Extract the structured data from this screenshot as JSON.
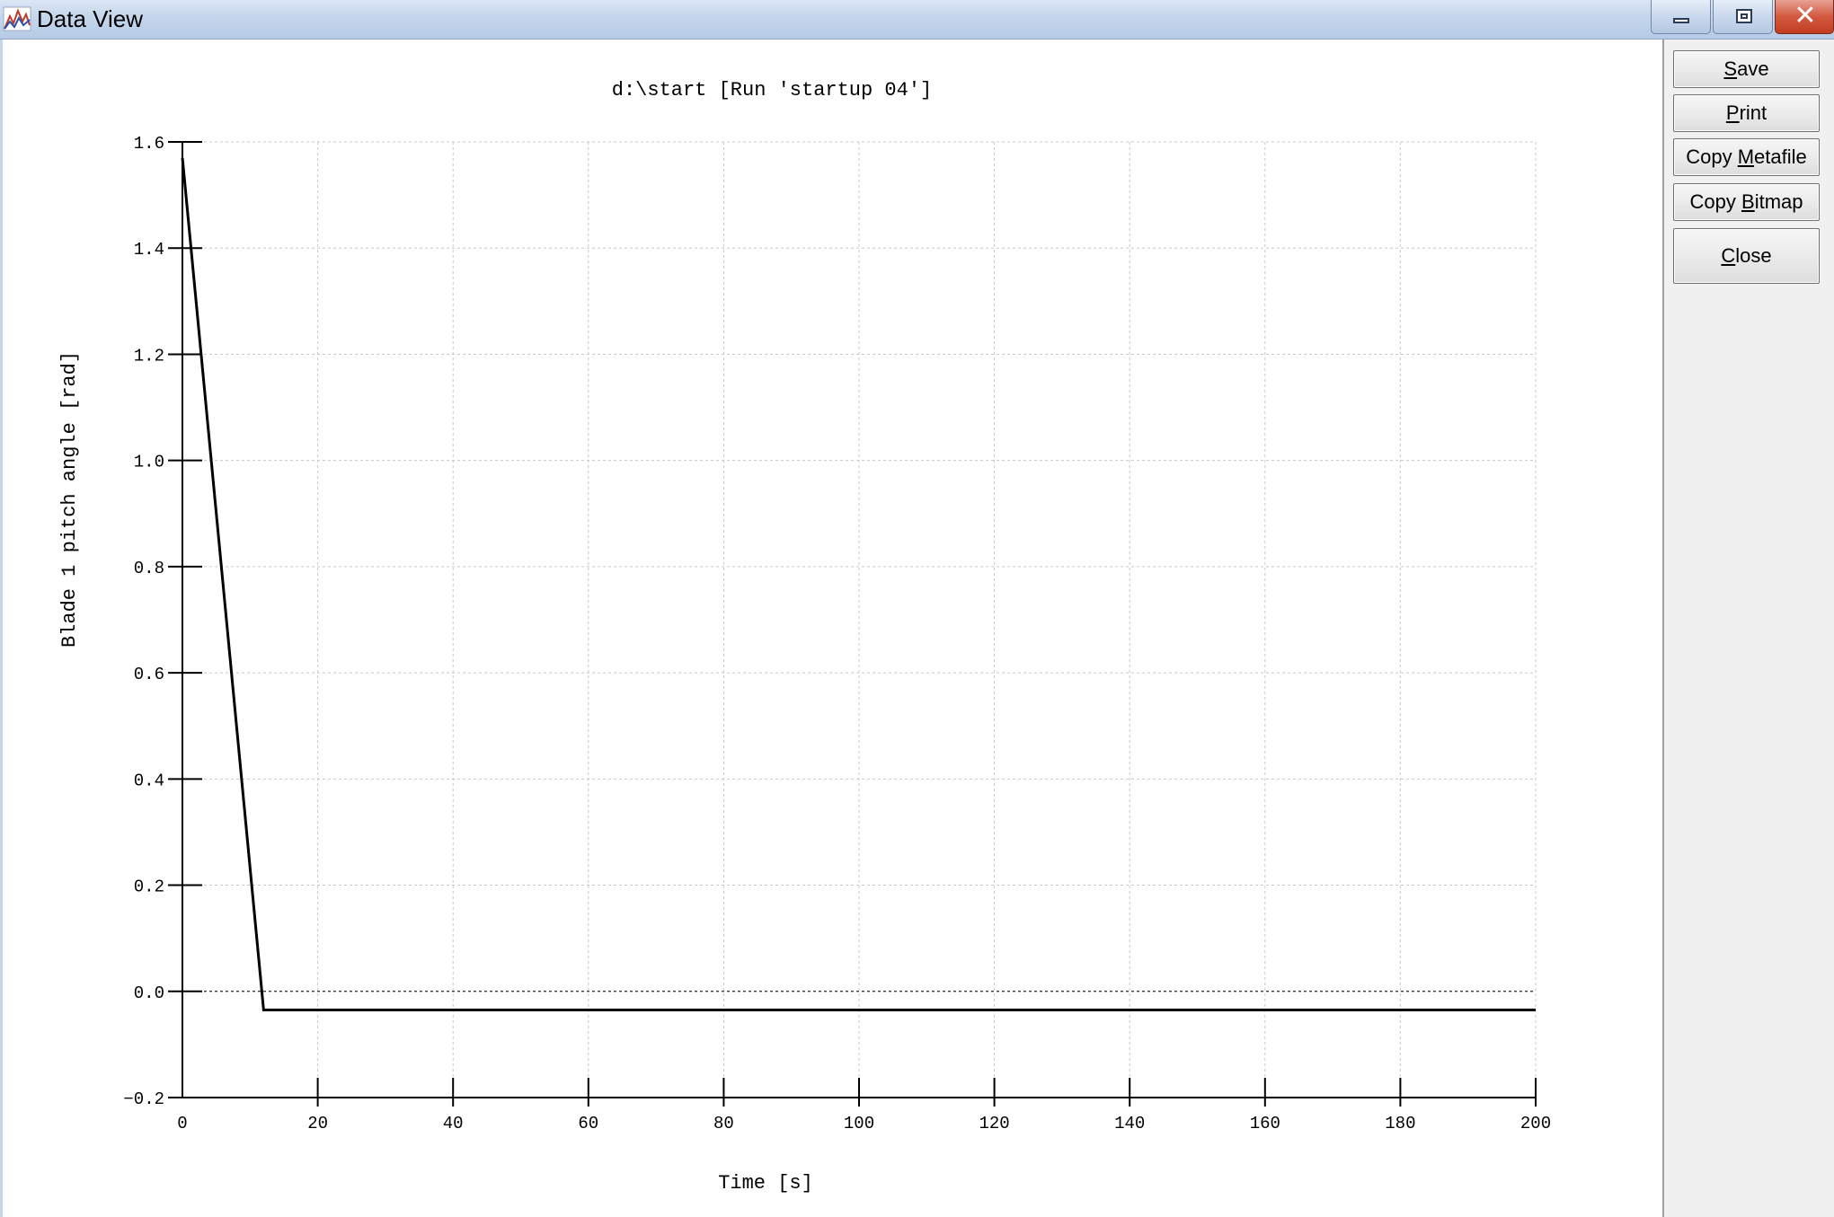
{
  "window": {
    "title": "Data View",
    "icon": "chart-app-icon",
    "controls": [
      "minimize-icon",
      "maximize-icon",
      "close-icon"
    ]
  },
  "side_panel": {
    "save": {
      "before": "",
      "mnemonic": "S",
      "after": "ave"
    },
    "print": {
      "before": "",
      "mnemonic": "P",
      "after": "rint"
    },
    "copy_metafile": {
      "before": "Copy ",
      "mnemonic": "M",
      "after": "etafile"
    },
    "copy_bitmap": {
      "before": "Copy ",
      "mnemonic": "B",
      "after": "itmap"
    },
    "close": {
      "before": "",
      "mnemonic": "C",
      "after": "lose"
    }
  },
  "chart_data": {
    "type": "line",
    "title": "d:\\start [Run 'startup 04']",
    "xlabel": "Time [s]",
    "ylabel": "Blade 1 pitch angle  [rad]",
    "xlim": [
      0,
      200
    ],
    "ylim": [
      -0.2,
      1.6
    ],
    "xticks": [
      0,
      20,
      40,
      60,
      80,
      100,
      120,
      140,
      160,
      180,
      200
    ],
    "yticks": [
      -0.2,
      0.0,
      0.2,
      0.4,
      0.6,
      0.8,
      1.0,
      1.2,
      1.4,
      1.6
    ],
    "xtick_labels": [
      "0",
      "20",
      "40",
      "60",
      "80",
      "100",
      "120",
      "140",
      "160",
      "180",
      "200"
    ],
    "ytick_labels": [
      "−0.2",
      "0.0",
      "0.2",
      "0.4",
      "0.6",
      "0.8",
      "1.0",
      "1.2",
      "1.4",
      "1.6"
    ],
    "grid": true,
    "zero_line": true,
    "series": [
      {
        "x": [
          0,
          12,
          200
        ],
        "y": [
          1.57,
          -0.035,
          -0.035
        ],
        "color": "#000000"
      }
    ]
  }
}
